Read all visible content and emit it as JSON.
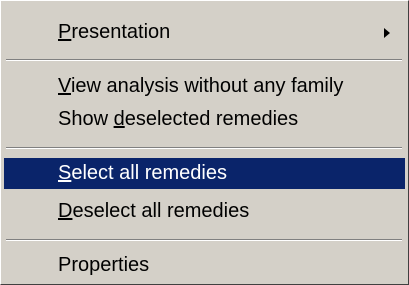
{
  "menu": {
    "items": [
      {
        "acc": "P",
        "rest": "resentation",
        "submenu": true
      },
      {
        "acc": "V",
        "rest": "iew analysis without any family"
      },
      {
        "pre": "Show ",
        "acc": "d",
        "rest": "eselected remedies"
      },
      {
        "acc": "S",
        "rest": "elect all remedies",
        "highlighted": true
      },
      {
        "acc": "D",
        "rest": "eselect all remedies"
      },
      {
        "label": "Properties"
      }
    ],
    "submenu_arrow_icon": "triangle-right",
    "colors": {
      "menu_bg": "#d4d0c8",
      "highlight_bg": "#0a246a",
      "highlight_text": "#ffffff",
      "text": "#000000"
    }
  }
}
